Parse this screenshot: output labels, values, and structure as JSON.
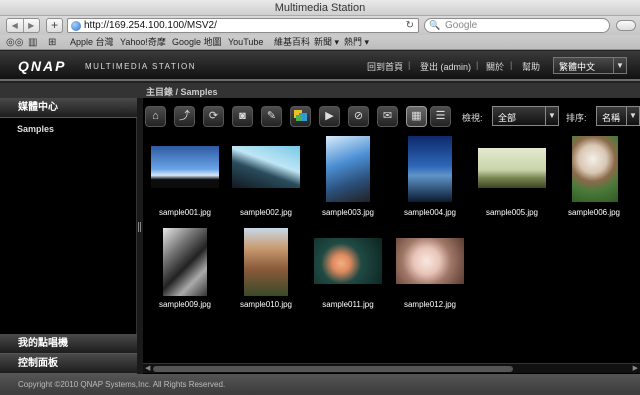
{
  "window": {
    "title": "Multimedia Station"
  },
  "browser": {
    "back_label": "◀",
    "forward_label": "▶",
    "new_tab_label": "+",
    "url": "http://169.254.100.100/MSV2/",
    "reload_icon": "reload-icon",
    "search_placeholder": "Google",
    "bookmarks": [
      "Apple 台灣",
      "Yahoo!奇摩",
      "Google 地圖",
      "YouTube",
      "維基百科",
      "新聞 ▾",
      "熱門 ▾"
    ]
  },
  "header": {
    "logo": "QNAP",
    "app_name": "Multimedia Station",
    "links": [
      "回到首頁",
      "登出 (admin)",
      "關於",
      "幫助"
    ],
    "language": "繁體中文"
  },
  "breadcrumb": "主目錄 / Samples",
  "sidebar": {
    "media_center": "媒體中心",
    "folder": "Samples",
    "my_jukebox": "我的點唱機",
    "control_panel": "控制面板"
  },
  "toolbar": {
    "buttons": [
      "home-icon",
      "upload-icon",
      "rotate-icon",
      "camera-icon",
      "edit-icon",
      "color-icon",
      "play-icon",
      "share-icon",
      "mail-icon"
    ],
    "view_label": "檢視:",
    "view_value": "全部",
    "sort_label": "排序:",
    "sort_value": "名稱"
  },
  "thumbnails": [
    {
      "name": "sample001.jpg"
    },
    {
      "name": "sample002.jpg"
    },
    {
      "name": "sample003.jpg"
    },
    {
      "name": "sample004.jpg"
    },
    {
      "name": "sample005.jpg"
    },
    {
      "name": "sample006.jpg"
    },
    {
      "name": "sample009.jpg"
    },
    {
      "name": "sample010.jpg"
    },
    {
      "name": "sample011.jpg"
    },
    {
      "name": "sample012.jpg"
    }
  ],
  "footer": "Copyright ©2010 QNAP Systems,Inc. All Rights Reserved.",
  "colors": {
    "accent": "#4f7fb8",
    "panel_bg": "#000000",
    "header_bg": "#1c1c1c"
  }
}
